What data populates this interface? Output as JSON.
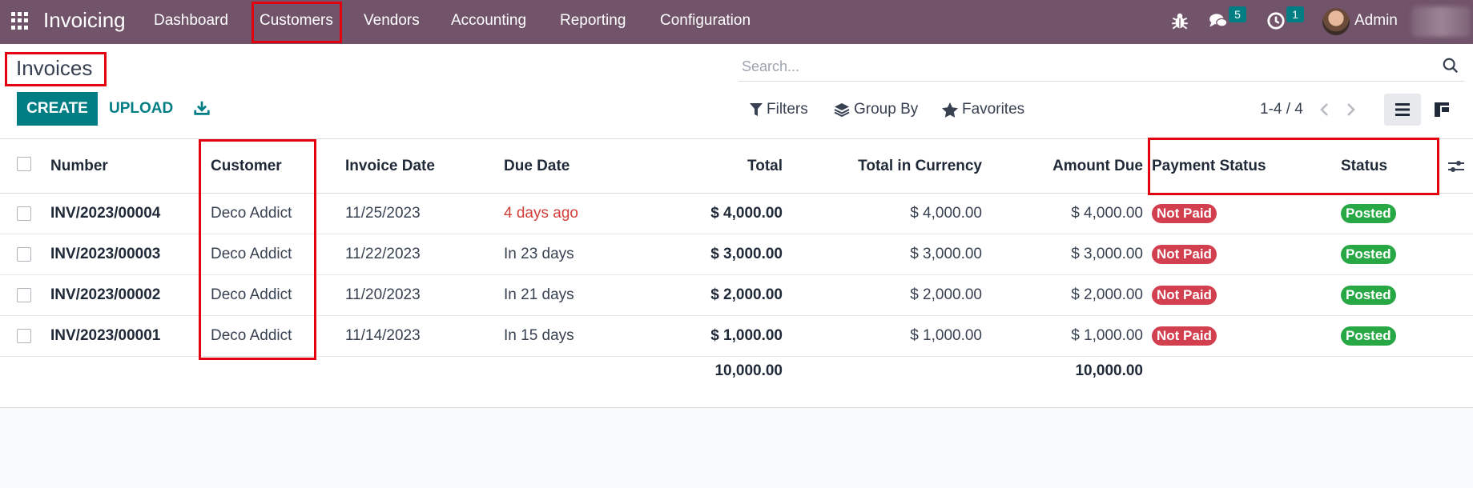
{
  "navbar": {
    "app_name": "Invoicing",
    "menu": [
      "Dashboard",
      "Customers",
      "Vendors",
      "Accounting",
      "Reporting",
      "Configuration"
    ],
    "messages_count": "5",
    "activities_count": "1",
    "user_name": "Admin",
    "icons": [
      "apps-grid-icon",
      "bug-icon",
      "chat-icon",
      "clock-icon"
    ]
  },
  "control_panel": {
    "title": "Invoices",
    "create_label": "CREATE",
    "upload_label": "UPLOAD",
    "search_placeholder": "Search...",
    "filters_label": "Filters",
    "group_by_label": "Group By",
    "favorites_label": "Favorites",
    "pager": "1-4 / 4"
  },
  "table": {
    "columns": [
      "Number",
      "Customer",
      "Invoice Date",
      "Due Date",
      "Total",
      "Total in Currency",
      "Amount Due",
      "Payment Status",
      "Status"
    ],
    "rows": [
      {
        "number": "INV/2023/00004",
        "customer": "Deco Addict",
        "invoice_date": "11/25/2023",
        "due_date": "4 days ago",
        "total": "$ 4,000.00",
        "total_currency": "$ 4,000.00",
        "amount_due": "$ 4,000.00",
        "payment_status": "Not Paid",
        "status": "Posted"
      },
      {
        "number": "INV/2023/00003",
        "customer": "Deco Addict",
        "invoice_date": "11/22/2023",
        "due_date": "In 23 days",
        "total": "$ 3,000.00",
        "total_currency": "$ 3,000.00",
        "amount_due": "$ 3,000.00",
        "payment_status": "Not Paid",
        "status": "Posted"
      },
      {
        "number": "INV/2023/00002",
        "customer": "Deco Addict",
        "invoice_date": "11/20/2023",
        "due_date": "In 21 days",
        "total": "$ 2,000.00",
        "total_currency": "$ 2,000.00",
        "amount_due": "$ 2,000.00",
        "payment_status": "Not Paid",
        "status": "Posted"
      },
      {
        "number": "INV/2023/00001",
        "customer": "Deco Addict",
        "invoice_date": "11/14/2023",
        "due_date": "In 15 days",
        "total": "$ 1,000.00",
        "total_currency": "$ 1,000.00",
        "amount_due": "$ 1,000.00",
        "payment_status": "Not Paid",
        "status": "Posted"
      }
    ],
    "totals": {
      "total": "10,000.00",
      "amount_due": "10,000.00"
    }
  },
  "colors": {
    "navbar": "#71536a",
    "primary": "#017e84",
    "overdue": "#d23f3a",
    "not_paid": "#d23f4e",
    "posted": "#28a745",
    "highlight": "#e3000f"
  }
}
